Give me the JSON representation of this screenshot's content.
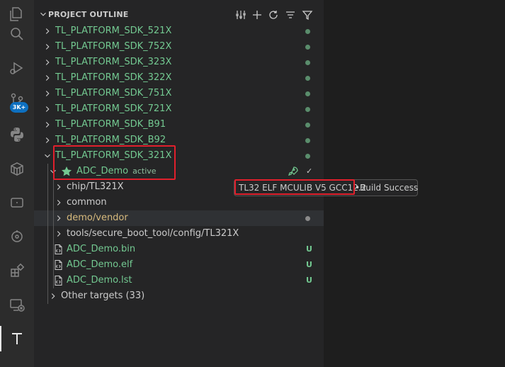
{
  "sidebar": {
    "header_title": "PROJECT OUTLINE",
    "header_icons": [
      "tools-icon",
      "add-icon",
      "refresh-icon",
      "collapse-all-icon",
      "filter-icon"
    ],
    "sdks": [
      {
        "label": "TL_PLATFORM_SDK_521X",
        "expanded": false
      },
      {
        "label": "TL_PLATFORM_SDK_752X",
        "expanded": false
      },
      {
        "label": "TL_PLATFORM_SDK_323X",
        "expanded": false
      },
      {
        "label": "TL_PLATFORM_SDK_322X",
        "expanded": false
      },
      {
        "label": "TL_PLATFORM_SDK_751X",
        "expanded": false
      },
      {
        "label": "TL_PLATFORM_SDK_721X",
        "expanded": false
      },
      {
        "label": "TL_PLATFORM_SDK_B91",
        "expanded": false
      },
      {
        "label": "TL_PLATFORM_SDK_B92",
        "expanded": false
      },
      {
        "label": "TL_PLATFORM_SDK_321X",
        "expanded": true
      }
    ],
    "project": {
      "label": "ADC_Demo",
      "tag": "active",
      "status_check": "✓"
    },
    "folders": [
      {
        "label": "chip/TL321X"
      },
      {
        "label": "common"
      },
      {
        "label": "demo/vendor"
      },
      {
        "label": "tools/secure_boot_tool/config/TL321X"
      }
    ],
    "files": [
      {
        "label": "ADC_Demo.bin",
        "badge": "U"
      },
      {
        "label": "ADC_Demo.elf",
        "badge": "U"
      },
      {
        "label": "ADC_Demo.lst",
        "badge": "U"
      }
    ],
    "other_targets": "Other targets (33)"
  },
  "tooltip": {
    "target": "TL32 ELF MCULIB V5 GCC12.2",
    "separator": "•",
    "status": "Build Success"
  },
  "activity_bar": {
    "badge": "3K+"
  },
  "colors": {
    "git_added": "#73c991",
    "git_modified": "#d7ba7d",
    "highlight": "#e0202c"
  }
}
